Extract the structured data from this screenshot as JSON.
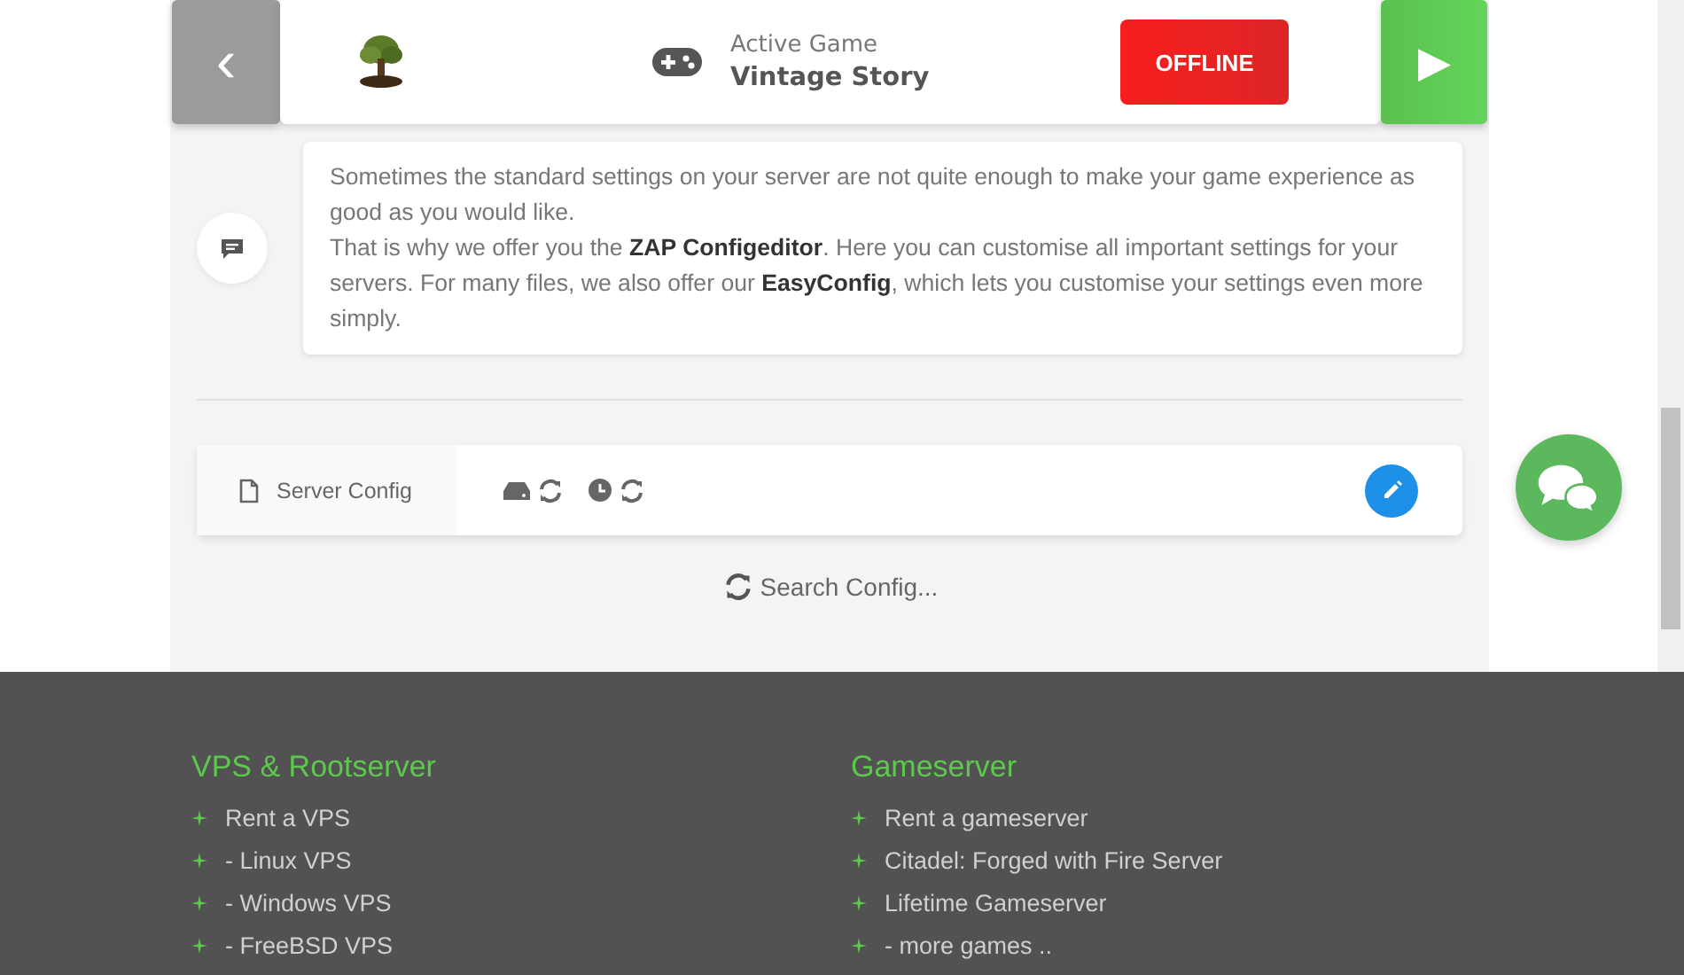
{
  "header": {
    "back_button": {
      "label": "‹"
    },
    "active_game": {
      "caption": "Active Game",
      "name": "Vintage Story"
    },
    "status": {
      "label": "OFFLINE",
      "kind": "offline"
    },
    "start_button": {
      "label": "▶"
    }
  },
  "info": {
    "paragraphs": [
      "Sometimes the standard settings on your server are not quite enough to make your game experience as good as you would like.",
      "That is why we offer you the **ZAP Configeditor**. Here you can customise all important settings for your servers. For many files, we also offer our **EasyConfig**, which lets you customise your settings even more simply."
    ]
  },
  "config_files": [
    {
      "name": "Server Config"
    }
  ],
  "search": {
    "label": "Search Config..."
  },
  "footer": {
    "columns": [
      {
        "title": "VPS & Rootserver",
        "links": [
          "Rent a VPS",
          "- Linux VPS",
          "- Windows VPS",
          "- FreeBSD VPS"
        ]
      },
      {
        "title": "Gameserver",
        "links": [
          "Rent a gameserver",
          "Citadel: Forged with Fire Server",
          "Lifetime Gameserver",
          "- more games .."
        ]
      }
    ]
  }
}
